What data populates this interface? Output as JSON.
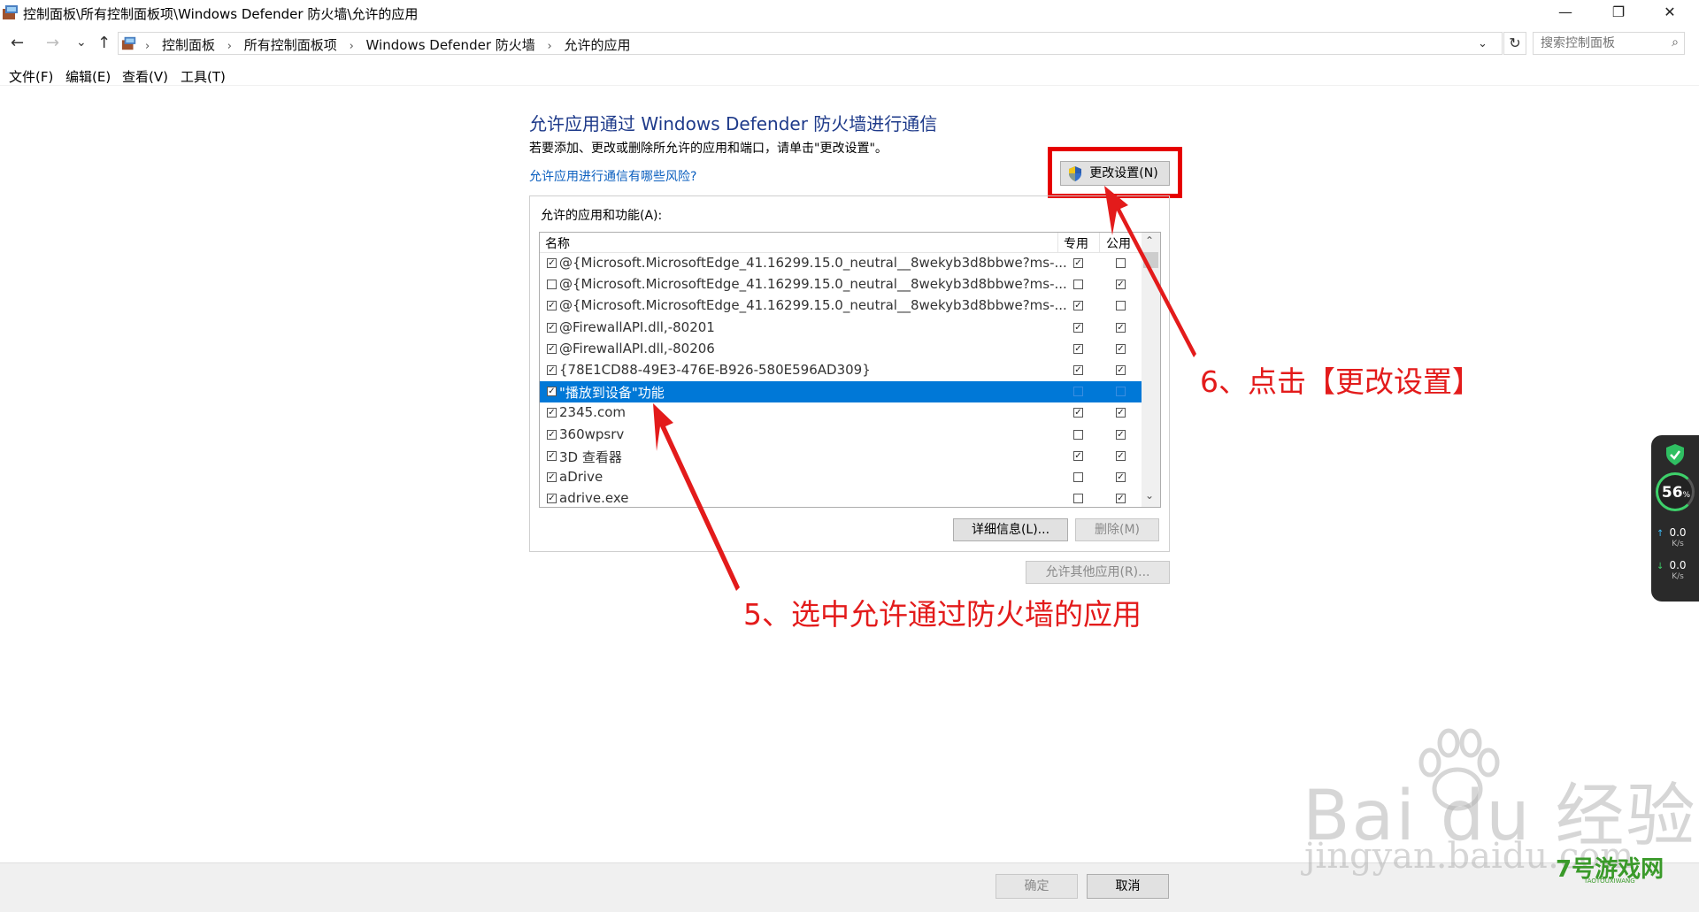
{
  "window": {
    "title": "控制面板\\所有控制面板项\\Windows Defender 防火墙\\允许的应用",
    "minimize_label": "—",
    "maximize_label": "❐",
    "close_label": "✕"
  },
  "nav": {
    "back": "←",
    "forward": "→",
    "recent": "⌄",
    "up": "↑"
  },
  "address": {
    "breadcrumbs": [
      "控制面板",
      "所有控制面板项",
      "Windows Defender 防火墙",
      "允许的应用"
    ],
    "separator": "›",
    "dropdown": "⌄",
    "refresh": "↻"
  },
  "search": {
    "placeholder": "搜索控制面板",
    "icon": "⌕"
  },
  "menu": [
    "文件(F)",
    "编辑(E)",
    "查看(V)",
    "工具(T)"
  ],
  "content": {
    "heading": "允许应用通过 Windows Defender 防火墙进行通信",
    "subtext": "若要添加、更改或删除所允许的应用和端口，请单击\"更改设置\"。",
    "risk_link": "允许应用进行通信有哪些风险?",
    "change_settings_label": "更改设置(N)"
  },
  "apps_group": {
    "label": "允许的应用和功能(A):",
    "columns": {
      "name": "名称",
      "private": "专用",
      "public": "公用"
    },
    "rows": [
      {
        "name": "@{Microsoft.MicrosoftEdge_41.16299.15.0_neutral__8wekyb3d8bbwe?ms-...",
        "enabled": true,
        "private": true,
        "public": false
      },
      {
        "name": "@{Microsoft.MicrosoftEdge_41.16299.15.0_neutral__8wekyb3d8bbwe?ms-...",
        "enabled": false,
        "private": false,
        "public": true
      },
      {
        "name": "@{Microsoft.MicrosoftEdge_41.16299.15.0_neutral__8wekyb3d8bbwe?ms-...",
        "enabled": true,
        "private": true,
        "public": false
      },
      {
        "name": "@FirewallAPI.dll,-80201",
        "enabled": true,
        "private": true,
        "public": true
      },
      {
        "name": "@FirewallAPI.dll,-80206",
        "enabled": true,
        "private": true,
        "public": true
      },
      {
        "name": "{78E1CD88-49E3-476E-B926-580E596AD309}",
        "enabled": true,
        "private": true,
        "public": true
      },
      {
        "name": "\"播放到设备\"功能",
        "enabled": true,
        "private": false,
        "public": false,
        "selected": true
      },
      {
        "name": "2345.com",
        "enabled": true,
        "private": true,
        "public": true
      },
      {
        "name": "360wpsrv",
        "enabled": true,
        "private": false,
        "public": true
      },
      {
        "name": "3D 查看器",
        "enabled": true,
        "private": true,
        "public": true
      },
      {
        "name": "aDrive",
        "enabled": true,
        "private": false,
        "public": true
      },
      {
        "name": "adrive.exe",
        "enabled": true,
        "private": false,
        "public": true
      }
    ],
    "details_label": "详细信息(L)...",
    "delete_label": "删除(M)",
    "allow_other_label": "允许其他应用(R)..."
  },
  "annotations": {
    "step6": "6、点击【更改设置】",
    "step5": "5、选中允许通过防火墙的应用"
  },
  "widget": {
    "percent": "56",
    "percent_symbol": "%",
    "upload": "0.0",
    "upload_unit": "K/s",
    "download": "0.0",
    "download_unit": "K/s"
  },
  "footer": {
    "ok_label": "确定",
    "cancel_label": "取消"
  },
  "watermarks": {
    "baidu": "Bai du 经验",
    "jingyan": "jingyan.baidu.com",
    "site": "7号游戏网",
    "site_sub": "TAOTOUXIWANG"
  },
  "colors": {
    "heading": "#1e3a8a",
    "link": "#0b5fbf",
    "selection": "#0078d7",
    "annotation_red": "#e31b1b"
  }
}
